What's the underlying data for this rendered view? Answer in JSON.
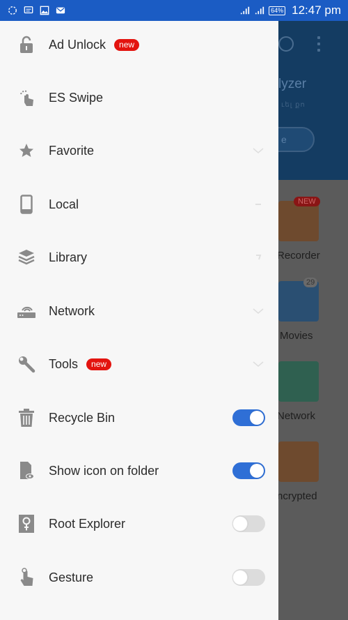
{
  "status_bar": {
    "notification_icons": [
      "sync-icon",
      "message-icon",
      "image-icon",
      "email-icon"
    ],
    "signal_icons": [
      "signal-sim1-icon",
      "signal-sim2-icon"
    ],
    "battery": "64%",
    "time": "12:47 pm"
  },
  "drawer": {
    "items": [
      {
        "label": "Ad Unlock",
        "icon": "lock-open-icon",
        "badge": "new"
      },
      {
        "label": "ES Swipe",
        "icon": "swipe-hand-icon"
      },
      {
        "label": "Favorite",
        "icon": "star-icon",
        "expandable": true
      },
      {
        "label": "Local",
        "icon": "phone-icon",
        "expandable": true
      },
      {
        "label": "Library",
        "icon": "layers-icon",
        "expandable": true
      },
      {
        "label": "Network",
        "icon": "router-icon",
        "expandable": true
      },
      {
        "label": "Tools",
        "icon": "wrench-icon",
        "badge": "new",
        "expandable": true
      },
      {
        "label": "Recycle Bin",
        "icon": "trash-icon",
        "toggle": true
      },
      {
        "label": "Show icon on folder",
        "icon": "folder-eye-icon",
        "toggle": true
      },
      {
        "label": "Root Explorer",
        "icon": "root-key-icon",
        "toggle": false
      },
      {
        "label": "Gesture",
        "icon": "gesture-hand-icon",
        "toggle": false
      }
    ]
  },
  "background_app": {
    "header_title_fragment": "lyzer",
    "header_subtitle_fragment": "ւել քո",
    "button_fragment": "e",
    "tiles": [
      {
        "label": "Recorder",
        "badge": "NEW",
        "color": "#7a4a22"
      },
      {
        "label": "Movies",
        "badge": "29",
        "color": "#1e4f7a"
      },
      {
        "label": "Network",
        "color": "#2f6a55"
      },
      {
        "label": "ncrypted",
        "color": "#7a4a22"
      }
    ]
  },
  "colors": {
    "status_bar": "#1b5cc4",
    "toggle_on": "#2f6fd6",
    "badge": "#e3140f",
    "drawer_bg": "#f7f7f7"
  }
}
